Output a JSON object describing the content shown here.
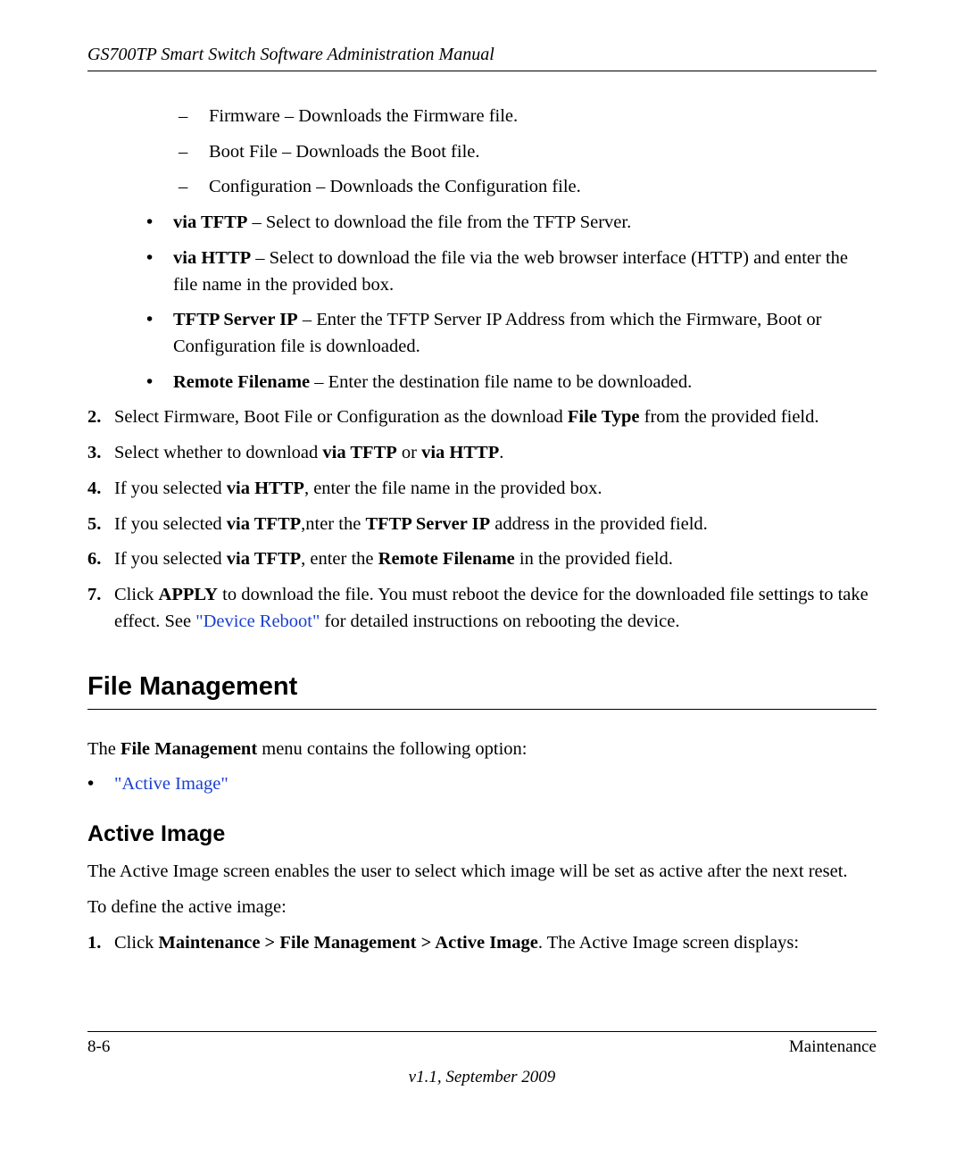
{
  "runningHead": "GS700TP Smart Switch Software Administration Manual",
  "dashItems": [
    "Firmware – Downloads the Firmware file.",
    "Boot File – Downloads the Boot file.",
    "Configuration – Downloads the Configuration file."
  ],
  "bullets": {
    "b1_bold": "via TFTP",
    "b1_rest": " – Select to download the file from the TFTP Server.",
    "b2_bold": "via HTTP",
    "b2_rest": " – Select to download the file via the web browser interface (HTTP) and enter the file name in the provided box.",
    "b3_bold": "TFTP Server IP",
    "b3_rest": " – Enter the TFTP Server IP Address from which the Firmware, Boot or Configuration file is downloaded.",
    "b4_bold": "Remote Filename",
    "b4_rest": " – Enter the destination file name to be downloaded."
  },
  "steps": {
    "s2": {
      "marker": "2.",
      "pre": "Select Firmware, Boot File or Configuration as the download ",
      "bold": "File Type",
      "post": " from the provided field."
    },
    "s3": {
      "marker": "3.",
      "t1": "Select whether to download ",
      "b1": "via TFTP",
      "t2": " or ",
      "b2": "via HTTP",
      "t3": "."
    },
    "s4": {
      "marker": "4.",
      "t1": "If you selected ",
      "b1": "via HTTP",
      "t2": ", enter the file name in the provided box."
    },
    "s5": {
      "marker": "5.",
      "t1": "If you selected ",
      "b1": "via TFTP",
      "t2": ",nter the ",
      "b2": "TFTP Server IP",
      "t3": " address in the provided field."
    },
    "s6": {
      "marker": "6.",
      "t1": "If you selected ",
      "b1": "via TFTP",
      "t2": ", enter the ",
      "b2": "Remote Filename",
      "t3": " in the provided field."
    },
    "s7": {
      "marker": "7.",
      "t1": "Click ",
      "b1": "APPLY",
      "t2": " to download the file. You must reboot the device for the downloaded file settings to take effect. See ",
      "link": "\"Device Reboot\"",
      "t3": " for detailed instructions on rebooting the device."
    }
  },
  "fileMgmt": {
    "heading": "File Management",
    "intro_pre": "The ",
    "intro_bold": "File Management",
    "intro_post": " menu contains the following option:",
    "bullet_link": "\"Active Image\""
  },
  "activeImage": {
    "heading": "Active Image",
    "p1": "The Active Image screen enables the user to select which image will be set as active after the next reset.",
    "p2": "To define the active image:",
    "s1": {
      "marker": "1.",
      "t1": "Click ",
      "b1": "Maintenance > File Management > Active Image",
      "t2": ". The Active Image screen displays:"
    }
  },
  "footer": {
    "left": "8-6",
    "right": "Maintenance",
    "version": "v1.1, September 2009"
  }
}
